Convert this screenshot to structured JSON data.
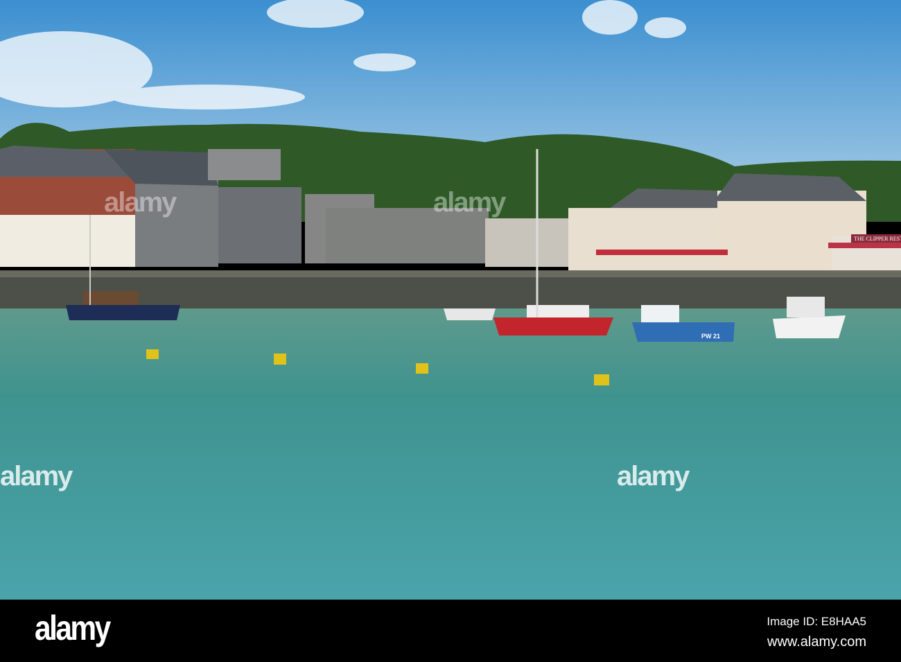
{
  "photo": {
    "signage": {
      "restaurant": "THE CLIPPER RESTA",
      "boat_registration": "PW 21"
    },
    "watermarks": [
      "alamy",
      "alamy",
      "alamy",
      "alamy"
    ]
  },
  "footer": {
    "logo": "alamy",
    "image_id": "Image ID: E8HAA5",
    "url": "www.alamy.com"
  }
}
